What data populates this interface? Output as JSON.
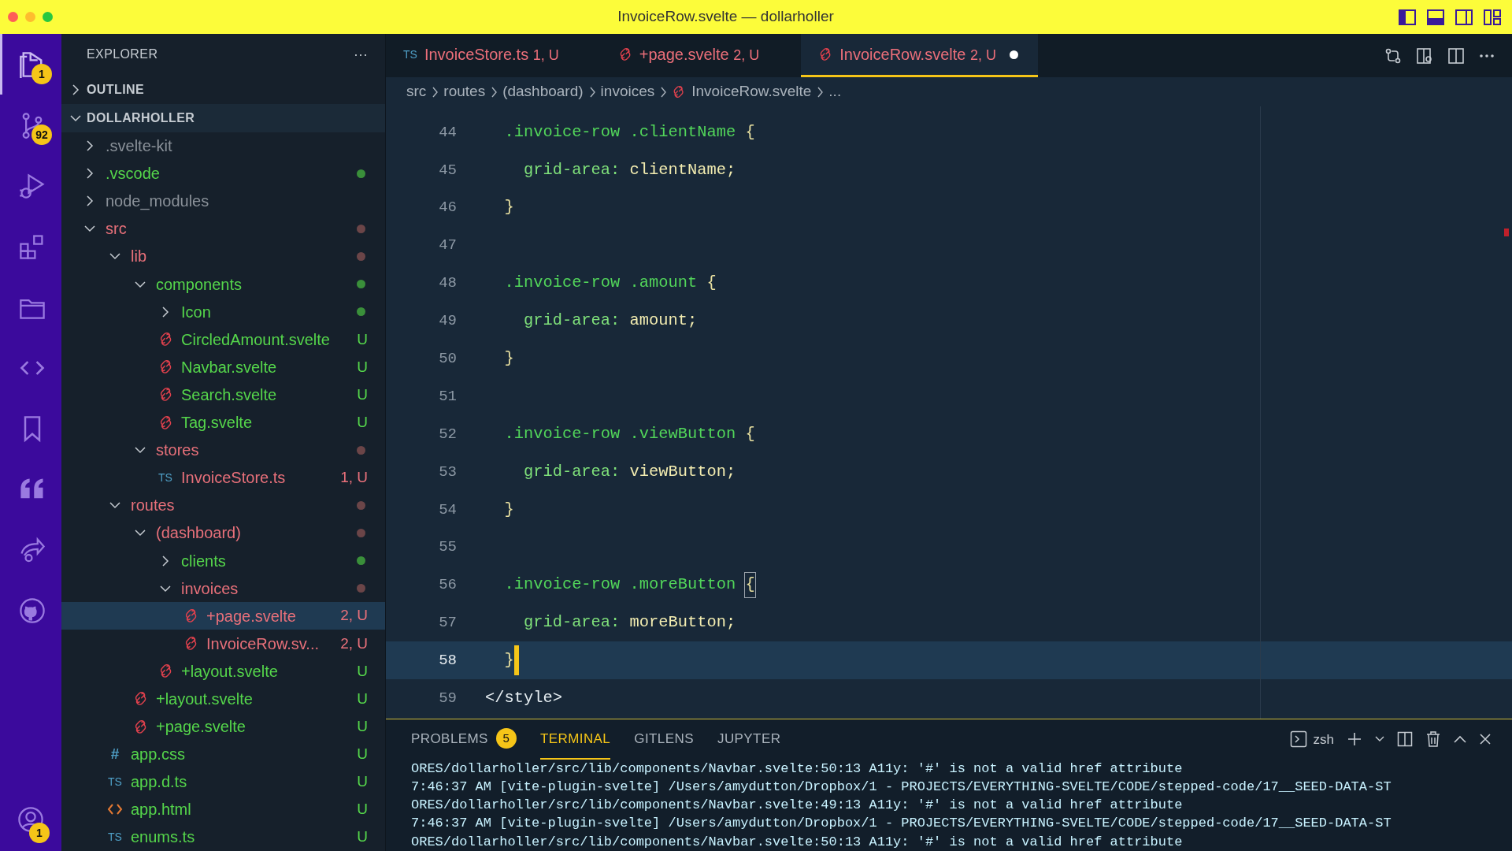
{
  "window": {
    "title": "InvoiceRow.svelte — dollarholler"
  },
  "activity_bar": [
    {
      "kind": "files",
      "selected": true,
      "badge": "1"
    },
    {
      "kind": "source-control",
      "selected": false,
      "badge": "92"
    },
    {
      "kind": "run-debug",
      "selected": false
    },
    {
      "kind": "extensions",
      "selected": false
    },
    {
      "kind": "folder",
      "selected": false
    },
    {
      "kind": "code",
      "selected": false
    },
    {
      "kind": "bookmark",
      "selected": false
    },
    {
      "kind": "quote",
      "selected": false
    },
    {
      "kind": "share",
      "selected": false
    },
    {
      "kind": "github",
      "selected": false
    }
  ],
  "account": {
    "badge": "1"
  },
  "sidebar": {
    "title": "EXPLORER",
    "more": "···",
    "sections": [
      {
        "label": "OUTLINE",
        "expanded": false
      },
      {
        "label": "DOLLARHOLLER",
        "expanded": true,
        "children": [
          {
            "label": ".svelte-kit",
            "kind": "folder",
            "expanded": false,
            "selected": false,
            "color": "#8a9199"
          },
          {
            "label": ".vscode",
            "kind": "folder",
            "expanded": false,
            "selected": false,
            "color": "#55d64b",
            "decoration": {
              "kind": "dot",
              "color": "#3a8f3a"
            }
          },
          {
            "label": "node_modules",
            "kind": "folder",
            "expanded": false,
            "selected": false,
            "color": "#8a9199"
          },
          {
            "label": "src",
            "kind": "folder",
            "expanded": true,
            "selected": false,
            "color": "#e8707a",
            "decoration": {
              "kind": "dot",
              "color": "#6b4548"
            },
            "children": [
              {
                "label": "lib",
                "kind": "folder",
                "expanded": true,
                "selected": false,
                "color": "#e8707a",
                "decoration": {
                  "kind": "dot",
                  "color": "#6b4548"
                },
                "children": [
                  {
                    "label": "components",
                    "kind": "folder",
                    "expanded": true,
                    "selected": false,
                    "color": "#55d64b",
                    "decoration": {
                      "kind": "dot",
                      "color": "#3a8f3a"
                    },
                    "children": [
                      {
                        "label": "Icon",
                        "kind": "folder",
                        "expanded": false,
                        "selected": false,
                        "color": "#55d64b",
                        "decoration": {
                          "kind": "dot",
                          "color": "#3a8f3a"
                        }
                      },
                      {
                        "label": "CircledAmount.svelte",
                        "kind": "svelte",
                        "selected": false,
                        "color": "#55d64b",
                        "decoration": {
                          "kind": "text",
                          "text": "U"
                        }
                      },
                      {
                        "label": "Navbar.svelte",
                        "kind": "svelte",
                        "selected": false,
                        "color": "#55d64b",
                        "decoration": {
                          "kind": "text",
                          "text": "U"
                        }
                      },
                      {
                        "label": "Search.svelte",
                        "kind": "svelte",
                        "selected": false,
                        "color": "#55d64b",
                        "decoration": {
                          "kind": "text",
                          "text": "U"
                        }
                      },
                      {
                        "label": "Tag.svelte",
                        "kind": "svelte",
                        "selected": false,
                        "color": "#55d64b",
                        "decoration": {
                          "kind": "text",
                          "text": "U"
                        }
                      }
                    ]
                  },
                  {
                    "label": "stores",
                    "kind": "folder",
                    "expanded": true,
                    "selected": false,
                    "color": "#e8707a",
                    "decoration": {
                      "kind": "dot",
                      "color": "#6b4548"
                    },
                    "children": [
                      {
                        "label": "InvoiceStore.ts",
                        "kind": "ts",
                        "icon_text": "TS",
                        "selected": false,
                        "color": "#e8707a",
                        "decoration": {
                          "kind": "text",
                          "text": "1, U"
                        }
                      }
                    ]
                  }
                ]
              },
              {
                "label": "routes",
                "kind": "folder",
                "expanded": true,
                "selected": false,
                "color": "#e8707a",
                "decoration": {
                  "kind": "dot",
                  "color": "#6b4548"
                },
                "children": [
                  {
                    "label": "(dashboard)",
                    "kind": "folder",
                    "expanded": true,
                    "selected": false,
                    "color": "#e8707a",
                    "decoration": {
                      "kind": "dot",
                      "color": "#6b4548"
                    },
                    "children": [
                      {
                        "label": "clients",
                        "kind": "folder",
                        "expanded": false,
                        "selected": false,
                        "color": "#55d64b",
                        "decoration": {
                          "kind": "dot",
                          "color": "#3a8f3a"
                        }
                      },
                      {
                        "label": "invoices",
                        "kind": "folder",
                        "expanded": true,
                        "selected": false,
                        "color": "#e8707a",
                        "decoration": {
                          "kind": "dot",
                          "color": "#6b4548"
                        },
                        "children": [
                          {
                            "label": "+page.svelte",
                            "kind": "svelte",
                            "selected": true,
                            "color": "#e8707a",
                            "decoration": {
                              "kind": "text",
                              "text": "2, U"
                            }
                          },
                          {
                            "label": "InvoiceRow.sv...",
                            "kind": "svelte",
                            "selected": false,
                            "color": "#e8707a",
                            "decoration": {
                              "kind": "text",
                              "text": "2, U"
                            }
                          }
                        ]
                      },
                      {
                        "label": "+layout.svelte",
                        "kind": "svelte",
                        "selected": false,
                        "color": "#55d64b",
                        "decoration": {
                          "kind": "text",
                          "text": "U"
                        }
                      }
                    ]
                  },
                  {
                    "label": "+layout.svelte",
                    "kind": "svelte",
                    "selected": false,
                    "color": "#55d64b",
                    "decoration": {
                      "kind": "text",
                      "text": "U"
                    }
                  },
                  {
                    "label": "+page.svelte",
                    "kind": "svelte",
                    "selected": false,
                    "color": "#55d64b",
                    "decoration": {
                      "kind": "text",
                      "text": "U"
                    }
                  }
                ]
              },
              {
                "label": "app.css",
                "kind": "css",
                "icon_text": "#",
                "selected": false,
                "color": "#55d64b",
                "decoration": {
                  "kind": "text",
                  "text": "U"
                }
              },
              {
                "label": "app.d.ts",
                "kind": "ts",
                "icon_text": "TS",
                "selected": false,
                "color": "#55d64b",
                "decoration": {
                  "kind": "text",
                  "text": "U"
                }
              },
              {
                "label": "app.html",
                "kind": "html",
                "selected": false,
                "color": "#55d64b",
                "decoration": {
                  "kind": "text",
                  "text": "U"
                }
              },
              {
                "label": "enums.ts",
                "kind": "ts",
                "icon_text": "TS",
                "selected": false,
                "color": "#55d64b",
                "decoration": {
                  "kind": "text",
                  "text": "U"
                }
              }
            ]
          }
        ]
      }
    ]
  },
  "tabs": [
    {
      "label": "InvoiceStore.ts",
      "kind": "ts",
      "icon_text": "TS",
      "status": "1, U",
      "selected": false,
      "dirty": false
    },
    {
      "label": "+page.svelte",
      "kind": "svelte",
      "status": "2, U",
      "selected": false,
      "dirty": false
    },
    {
      "label": "InvoiceRow.svelte",
      "kind": "svelte",
      "status": "2, U",
      "selected": true,
      "dirty": true
    }
  ],
  "breadcrumb": [
    {
      "label": "src"
    },
    {
      "label": "routes"
    },
    {
      "label": "(dashboard)"
    },
    {
      "label": "invoices"
    },
    {
      "label": "InvoiceRow.svelte",
      "kind": "svelte"
    },
    {
      "label": "..."
    }
  ],
  "editor": {
    "lines": [
      {
        "number": "44",
        "current": false,
        "tokens": [
          {
            "kind": "selector",
            "text": "  .invoice-row .clientName"
          },
          {
            "kind": "punct",
            "text": "{"
          }
        ]
      },
      {
        "number": "45",
        "current": false,
        "tokens": [
          {
            "kind": "property",
            "text": "    grid-area:"
          },
          {
            "kind": "value",
            "text": "clientName;"
          }
        ]
      },
      {
        "number": "46",
        "current": false,
        "tokens": [
          {
            "kind": "punct",
            "text": "  }"
          }
        ]
      },
      {
        "number": "47",
        "current": false
      },
      {
        "number": "48",
        "current": false,
        "tokens": [
          {
            "kind": "selector",
            "text": "  .invoice-row .amount"
          },
          {
            "kind": "punct",
            "text": "{"
          }
        ]
      },
      {
        "number": "49",
        "current": false,
        "tokens": [
          {
            "kind": "property",
            "text": "    grid-area:"
          },
          {
            "kind": "value",
            "text": "amount;"
          }
        ]
      },
      {
        "number": "50",
        "current": false,
        "tokens": [
          {
            "kind": "punct",
            "text": "  }"
          }
        ]
      },
      {
        "number": "51",
        "current": false
      },
      {
        "number": "52",
        "current": false,
        "tokens": [
          {
            "kind": "selector",
            "text": "  .invoice-row .viewButton"
          },
          {
            "kind": "punct",
            "text": "{"
          }
        ]
      },
      {
        "number": "53",
        "current": false,
        "tokens": [
          {
            "kind": "property",
            "text": "    grid-area:"
          },
          {
            "kind": "value",
            "text": "viewButton;"
          }
        ]
      },
      {
        "number": "54",
        "current": false,
        "tokens": [
          {
            "kind": "punct",
            "text": "  }"
          }
        ]
      },
      {
        "number": "55",
        "current": false
      },
      {
        "number": "56",
        "current": false,
        "tokens": [
          {
            "kind": "selector",
            "text": "  .invoice-row .moreButton"
          },
          {
            "kind": "bracket-match",
            "text": "{"
          }
        ]
      },
      {
        "number": "57",
        "current": false,
        "tokens": [
          {
            "kind": "property",
            "text": "    grid-area:"
          },
          {
            "kind": "value",
            "text": "moreButton;"
          }
        ]
      },
      {
        "number": "58",
        "current": true,
        "tokens": [
          {
            "kind": "punct",
            "text": "  }"
          }
        ]
      },
      {
        "number": "59",
        "current": false,
        "tokens": [
          {
            "kind": "tag",
            "text": "</style>"
          }
        ]
      }
    ]
  },
  "panel": {
    "tabs": [
      {
        "label": "PROBLEMS",
        "badge": "5",
        "selected": false
      },
      {
        "label": "TERMINAL",
        "selected": true
      },
      {
        "label": "GITLENS",
        "selected": false
      },
      {
        "label": "JUPYTER",
        "selected": false
      }
    ],
    "shell": "zsh",
    "terminal_lines": [
      "ORES/dollarholler/src/lib/components/Navbar.svelte:50:13 A11y: '#' is not a valid href attribute",
      "7:46:37 AM [vite-plugin-svelte] /Users/amydutton/Dropbox/1 - PROJECTS/EVERYTHING-SVELTE/CODE/stepped-code/17__SEED-DATA-ST",
      "ORES/dollarholler/src/lib/components/Navbar.svelte:49:13 A11y: '#' is not a valid href attribute",
      "7:46:37 AM [vite-plugin-svelte] /Users/amydutton/Dropbox/1 - PROJECTS/EVERYTHING-SVELTE/CODE/stepped-code/17__SEED-DATA-ST",
      "ORES/dollarholler/src/lib/components/Navbar.svelte:50:13 A11y: '#' is not a valid href attribute"
    ]
  }
}
